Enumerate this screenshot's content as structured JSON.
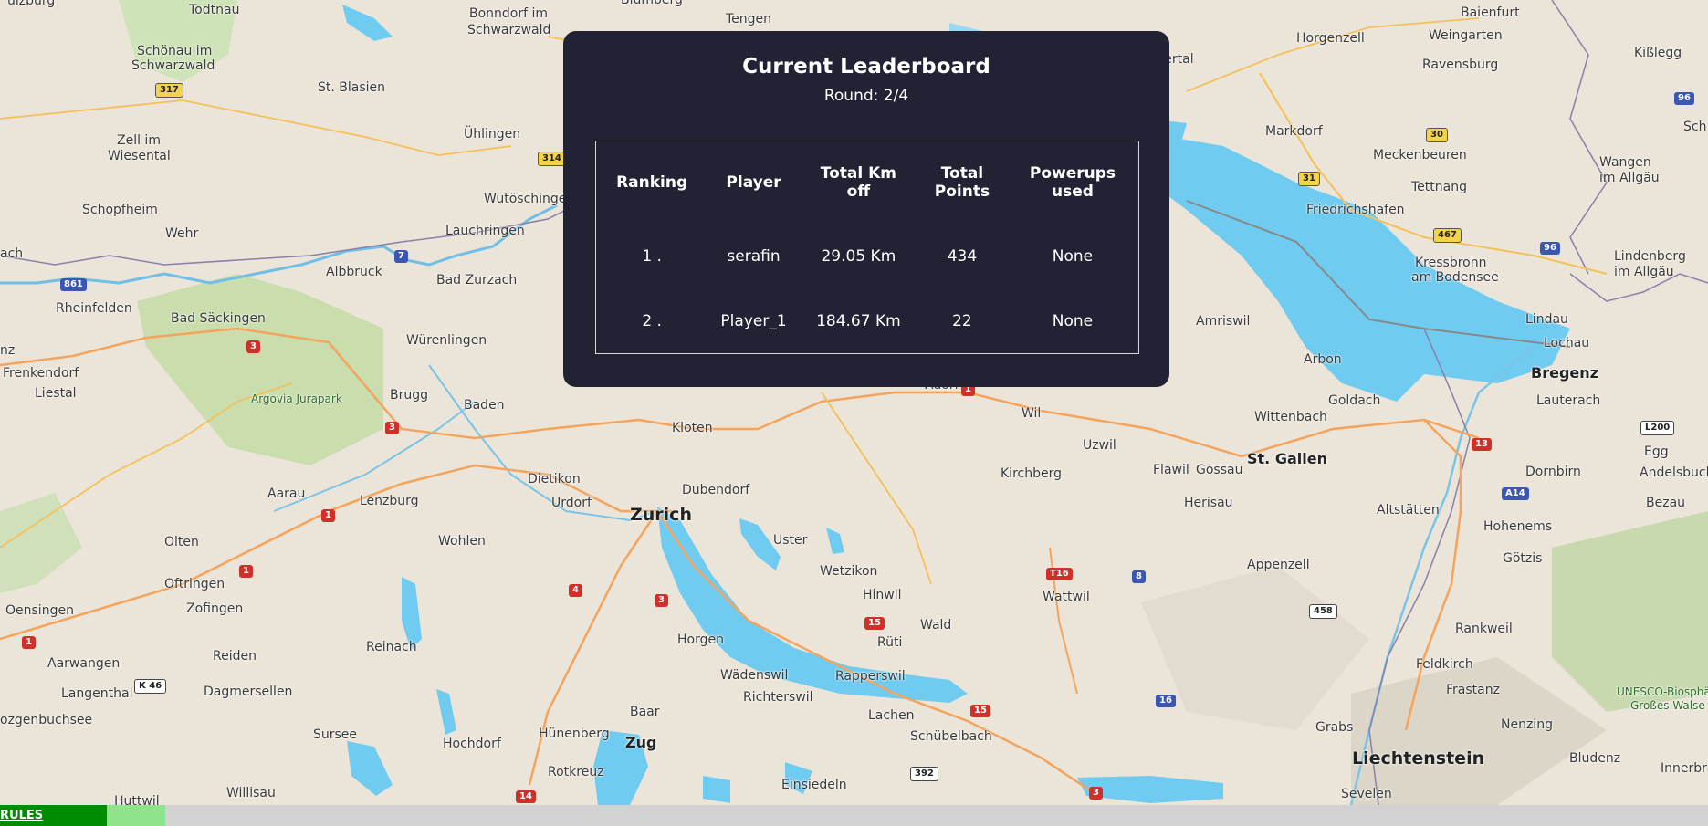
{
  "leaderboard": {
    "title": "Current Leaderboard",
    "round": "Round: 2/4",
    "headers": {
      "ranking": "Ranking",
      "player": "Player",
      "km_line1": "Total Km",
      "km_line2": "off",
      "points_line1": "Total",
      "points_line2": "Points",
      "powerups_line1": "Powerups",
      "powerups_line2": "used"
    },
    "rows": [
      {
        "ranking": "1 .",
        "player": "serafin",
        "km": "29.05 Km",
        "points": "434",
        "powerups": "None"
      },
      {
        "ranking": "2 .",
        "player": "Player_1",
        "km": "184.67 Km",
        "points": "22",
        "powerups": "None"
      }
    ]
  },
  "bottom_bar": {
    "rules_label": "RULES",
    "progress_fraction": 0.5
  },
  "map": {
    "places": [
      "Todtnau",
      "Bonndorf im",
      "Schwarzwald",
      "Blumberg",
      "Tengen",
      "Schönau im",
      "Schwarzwald",
      "St. Blasien",
      "Zell im",
      "Wiesental",
      "Ühlingen",
      "Schopfheim",
      "Wehr",
      "Wutöschingen",
      "Lauchringen",
      "Albbruck",
      "Bad Zurzach",
      "Rheinfelden",
      "Bad Säckingen",
      "Würenlingen",
      "Frenkendorf",
      "Liestal",
      "Argovia Jurapark",
      "Brugg",
      "Baden",
      "Kloten",
      "Dietikon",
      "Urdorf",
      "Dubendorf",
      "Zurich",
      "Aarau",
      "Lenzburg",
      "Wohlen",
      "Olten",
      "Oftringen",
      "Zofingen",
      "Oensingen",
      "Aarwangen",
      "Langenthal",
      "Reiden",
      "Dagmersellen",
      "Reinach",
      "Uster",
      "Wetzikon",
      "Hinwil",
      "Wald",
      "Rüti",
      "Horgen",
      "Wädenswil",
      "Richterswil",
      "Rapperswil",
      "Lachen",
      "Baar",
      "Zug",
      "Hünenberg",
      "Rotkreuz",
      "Einsiedeln",
      "Schübelbach",
      "Sursee",
      "Hochdorf",
      "Willisau",
      "Huttwil",
      "ozgenbuchsee",
      "Wil",
      "Uzwil",
      "Flawil",
      "Gossau",
      "Kirchberg",
      "Herisau",
      "St. Gallen",
      "Wattwil",
      "Appenzell",
      "Altstätten",
      "Amriswil",
      "Arbon",
      "Wittenbach",
      "Goldach",
      "Deggenhausertal",
      "Horgenzell",
      "Weingarten",
      "Baienfurt",
      "Kißlegg",
      "Ravensburg",
      "Markdorf",
      "Meckenbeuren",
      "Tettnang",
      "Friedrichshafen",
      "Kressbronn",
      "am Bodensee",
      "Lindau",
      "Wangen",
      "im Allgäu",
      "Lindenberg",
      "im Allgäu",
      "Bregenz",
      "Lochau",
      "Lauterach",
      "Dornbirn",
      "Egg",
      "Andelsbuch",
      "Bezau",
      "Hohenems",
      "Götzis",
      "Rankweil",
      "Feldkirch",
      "Frastanz",
      "Nenzing",
      "Bludenz",
      "Liechtenstein",
      "Grabs",
      "Sevelen",
      "UNESCO-Biosphä",
      "Großes Walse",
      "Innerbra",
      "Adorf",
      "Sch",
      "ach",
      "nz",
      "ulzburg"
    ],
    "road_numbers": [
      "317",
      "314",
      "7",
      "861",
      "3",
      "3",
      "1",
      "1",
      "1",
      "4",
      "3",
      "15",
      "15",
      "14",
      "K 46",
      "392",
      "3",
      "8",
      "T16",
      "458",
      "16",
      "13",
      "A14",
      "L200",
      "30",
      "31",
      "467",
      "96",
      "96",
      "1"
    ]
  }
}
